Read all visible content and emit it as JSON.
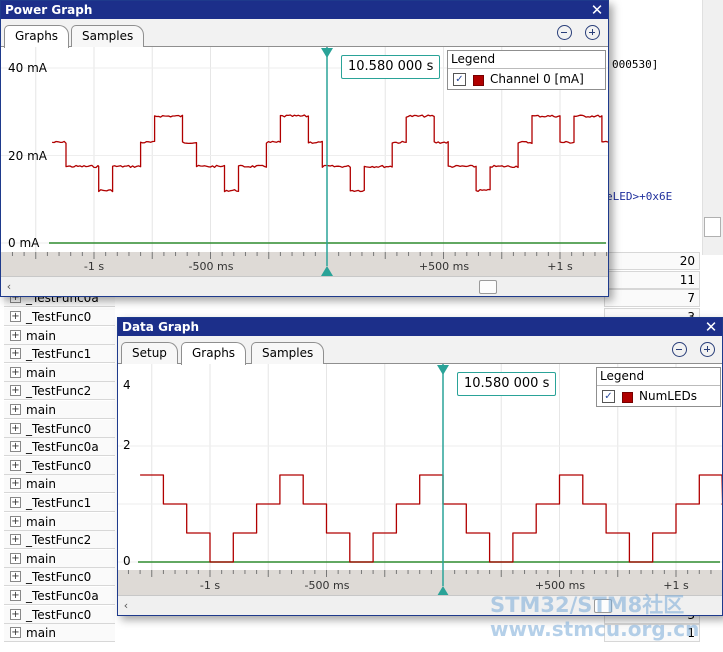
{
  "background": {
    "code_lines": [
      "000530]",
      "eLED>+0x6E"
    ],
    "rows": [
      {
        "label": "",
        "value": "20"
      },
      {
        "label": "",
        "value": "11"
      },
      {
        "label": "_TestFunc0a",
        "value": "7"
      },
      {
        "label": "_TestFunc0",
        "value": "3"
      },
      {
        "label": "main",
        "value": ""
      },
      {
        "label": "_TestFunc1",
        "value": ""
      },
      {
        "label": "main",
        "value": ""
      },
      {
        "label": "_TestFunc2",
        "value": ""
      },
      {
        "label": "main",
        "value": ""
      },
      {
        "label": "_TestFunc0",
        "value": ""
      },
      {
        "label": "_TestFunc0a",
        "value": ""
      },
      {
        "label": "_TestFunc0",
        "value": ""
      },
      {
        "label": "main",
        "value": ""
      },
      {
        "label": "_TestFunc1",
        "value": ""
      },
      {
        "label": "main",
        "value": ""
      },
      {
        "label": "_TestFunc2",
        "value": ""
      },
      {
        "label": "main",
        "value": ""
      },
      {
        "label": "_TestFunc0",
        "value": ""
      },
      {
        "label": "_TestFunc0a",
        "value": ""
      },
      {
        "label": "_TestFunc0",
        "value": "3"
      },
      {
        "label": "main",
        "value": "1"
      }
    ]
  },
  "power_graph": {
    "title": "Power Graph",
    "close_glyph": "✕",
    "tabs": [
      "Graphs",
      "Samples"
    ],
    "active_tab": 0,
    "zoom_out_icon": "minus-circle-icon",
    "zoom_in_icon": "plus-circle-icon",
    "cursor_time": "10.580 000 s",
    "legend": {
      "title": "Legend",
      "check_glyph": "✓",
      "items": [
        {
          "name": "Channel 0 [mA]",
          "color": "#b00000"
        }
      ]
    },
    "y_ticks": [
      {
        "value": 40,
        "label": "40 mA"
      },
      {
        "value": 20,
        "label": "20 mA"
      },
      {
        "value": 0,
        "label": "0 mA"
      }
    ],
    "x_ticks": [
      {
        "value": -1,
        "label": "-1 s"
      },
      {
        "value": -0.5,
        "label": "-500 ms"
      },
      {
        "value": 0.5,
        "label": "+500 ms"
      },
      {
        "value": 1,
        "label": "+1 s"
      }
    ],
    "scroll_left": "‹"
  },
  "data_graph": {
    "title": "Data Graph",
    "close_glyph": "✕",
    "tabs": [
      "Setup",
      "Graphs",
      "Samples"
    ],
    "active_tab": 1,
    "zoom_out_icon": "minus-circle-icon",
    "zoom_in_icon": "plus-circle-icon",
    "cursor_time": "10.580 000 s",
    "legend": {
      "title": "Legend",
      "check_glyph": "✓",
      "items": [
        {
          "name": "NumLEDs",
          "color": "#b00000"
        }
      ]
    },
    "y_ticks": [
      {
        "value": 4,
        "label": "4"
      },
      {
        "value": 2,
        "label": "2"
      },
      {
        "value": 0,
        "label": "0"
      }
    ],
    "x_ticks": [
      {
        "value": -1,
        "label": "-1 s"
      },
      {
        "value": -0.5,
        "label": "-500 ms"
      },
      {
        "value": 0.5,
        "label": "+500 ms"
      },
      {
        "value": 1,
        "label": "+1 s"
      }
    ],
    "scroll_left": "‹"
  },
  "colors": {
    "trace": "#b00000",
    "baseline": "#2e8b2e",
    "cursor": "#2aa398",
    "titlebar": "#1c2f8a"
  },
  "chart_data": [
    {
      "type": "line",
      "title": "Power Graph",
      "ylabel": "",
      "xlabel": "",
      "ylim": [
        0,
        40
      ],
      "x_unit": "s (relative to cursor)",
      "series": [
        {
          "name": "Channel 0 [mA]",
          "x": [
            -1.18,
            -1.12,
            -0.98,
            -0.92,
            -0.8,
            -0.74,
            -0.62,
            -0.56,
            -0.44,
            -0.38,
            -0.26,
            -0.2,
            -0.08,
            -0.02,
            0.1,
            0.16,
            0.28,
            0.34,
            0.46,
            0.52,
            0.64,
            0.7,
            0.82,
            0.88,
            1.0,
            1.06,
            1.18
          ],
          "values": [
            23,
            17.5,
            12,
            17.5,
            23,
            29,
            23,
            17.5,
            12,
            17.5,
            23,
            29,
            23,
            17.5,
            12,
            17.5,
            23,
            29,
            23,
            17.5,
            12,
            17.5,
            23,
            29,
            23,
            29,
            23
          ]
        }
      ],
      "baseline": 0
    },
    {
      "type": "line",
      "title": "Data Graph",
      "ylabel": "",
      "xlabel": "",
      "ylim": [
        0,
        4
      ],
      "x_unit": "s (relative to cursor)",
      "series": [
        {
          "name": "NumLEDs",
          "x": [
            -1.3,
            -1.2,
            -1.1,
            -1.0,
            -0.9,
            -0.8,
            -0.7,
            -0.6,
            -0.5,
            -0.4,
            -0.3,
            -0.2,
            -0.1,
            0.0,
            0.1,
            0.2,
            0.3,
            0.4,
            0.5,
            0.6,
            0.7,
            0.8,
            0.9,
            1.0,
            1.1,
            1.2,
            1.3
          ],
          "values": [
            3,
            2,
            1,
            0,
            1,
            2,
            3,
            2,
            1,
            0,
            1,
            2,
            3,
            2,
            1,
            0,
            1,
            2,
            3,
            2,
            1,
            0,
            1,
            2,
            3,
            2,
            1
          ]
        }
      ],
      "baseline": 0
    }
  ],
  "watermark": {
    "line1": "STM32/STM8社区",
    "line2": "www.stmcu.org.cn"
  }
}
